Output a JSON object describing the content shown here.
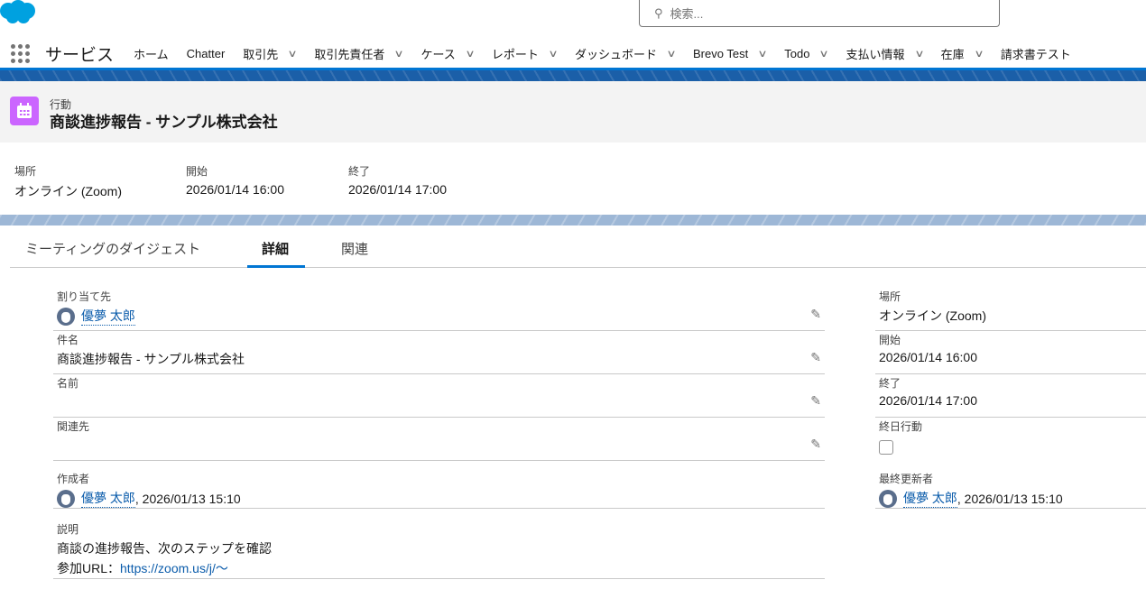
{
  "header": {
    "search_placeholder": "検索...",
    "app_name": "サービス"
  },
  "nav": [
    {
      "label": "ホーム",
      "dropdown": false
    },
    {
      "label": "Chatter",
      "dropdown": false
    },
    {
      "label": "取引先",
      "dropdown": true
    },
    {
      "label": "取引先責任者",
      "dropdown": true
    },
    {
      "label": "ケース",
      "dropdown": true
    },
    {
      "label": "レポート",
      "dropdown": true
    },
    {
      "label": "ダッシュボード",
      "dropdown": true
    },
    {
      "label": "Brevo Test",
      "dropdown": true
    },
    {
      "label": "Todo",
      "dropdown": true
    },
    {
      "label": "支払い情報",
      "dropdown": true
    },
    {
      "label": "在庫",
      "dropdown": true
    },
    {
      "label": "請求書テスト",
      "dropdown": false
    }
  ],
  "record": {
    "object_type": "行動",
    "title": "商談進捗報告 - サンプル株式会社"
  },
  "highlights": [
    {
      "label": "場所",
      "value": "オンライン (Zoom)"
    },
    {
      "label": "開始",
      "value": "2026/01/14 16:00"
    },
    {
      "label": "終了",
      "value": "2026/01/14 17:00"
    }
  ],
  "tabs": [
    "ミーティングのダイジェスト",
    "詳細",
    "関連"
  ],
  "active_tab": "詳細",
  "details": {
    "assigned_label": "割り当て先",
    "assigned_user": "優夢 太郎",
    "subject_label": "件名",
    "subject": "商談進捗報告 - サンプル株式会社",
    "name_label": "名前",
    "related_label": "関連先",
    "created_label": "作成者",
    "created_user": "優夢 太郎",
    "created_date": ", 2026/01/13 15:10",
    "desc_label": "説明",
    "desc_line1": "商談の進捗報告、次のステップを確認",
    "desc_url_prefix": "参加URL：",
    "desc_url": "https://zoom.us/j/〜",
    "location_label": "場所",
    "location": "オンライン (Zoom)",
    "start_label": "開始",
    "start": "2026/01/14 16:00",
    "end_label": "終了",
    "end": "2026/01/14 17:00",
    "allday_label": "終日行動",
    "allday": false,
    "modified_label": "最終更新者",
    "modified_user": "優夢 太郎",
    "modified_date": ", 2026/01/13 15:10"
  },
  "colors": {
    "brand": "#0176d3",
    "object_icon": "#cb65ff",
    "link": "#0b5cab"
  }
}
